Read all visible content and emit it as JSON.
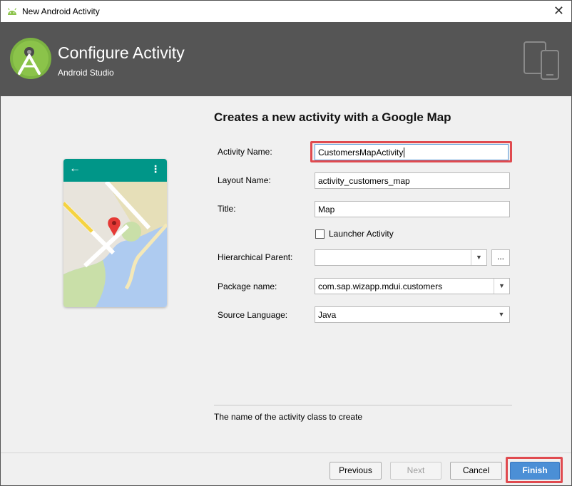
{
  "window": {
    "title": "New Android Activity",
    "close_glyph": "✕"
  },
  "header": {
    "heading": "Configure Activity",
    "subheading": "Android Studio",
    "logo_icon": "android-studio-logo-icon",
    "device_icon": "tablet-phone-icon"
  },
  "preview": {
    "back_glyph": "←",
    "menu_glyph": "⋮",
    "accent_color": "#009688"
  },
  "form": {
    "title": "Creates a new activity with a Google Map",
    "activity_name": {
      "label": "Activity Name:",
      "value": "CustomersMapActivity"
    },
    "layout_name": {
      "label": "Layout Name:",
      "value": "activity_customers_map"
    },
    "title_field": {
      "label": "Title:",
      "value": "Map"
    },
    "launcher": {
      "label": "Launcher Activity",
      "checked": false
    },
    "hierarchical_parent": {
      "label": "Hierarchical Parent:",
      "value": "",
      "browse_label": "..."
    },
    "package_name": {
      "label": "Package name:",
      "value": "com.sap.wizapp.mdui.customers"
    },
    "source_language": {
      "label": "Source Language:",
      "value": "Java"
    },
    "dropdown_glyph": "▼"
  },
  "hint": "The name of the activity class to create",
  "footer": {
    "previous_label": "Previous",
    "next_label": "Next",
    "cancel_label": "Cancel",
    "finish_label": "Finish"
  },
  "colors": {
    "header_bg": "#555555",
    "highlight": "#e04a4f",
    "primary_button": "#4b8fd6"
  }
}
